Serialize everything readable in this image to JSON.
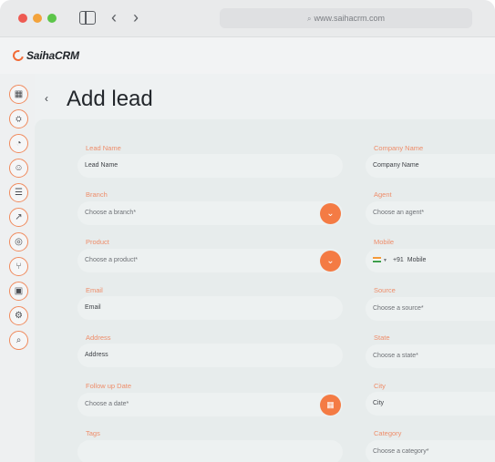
{
  "browser": {
    "url": "www.saihacrm.com"
  },
  "app": {
    "brand": "SaihaCRM"
  },
  "rail": {
    "items": [
      {
        "icon": "dashboard-icon",
        "glyph": "▦"
      },
      {
        "icon": "handshake-icon",
        "glyph": "🤝"
      },
      {
        "icon": "chart-pie-icon",
        "glyph": "◔"
      },
      {
        "icon": "people-icon",
        "glyph": "☺"
      },
      {
        "icon": "report-icon",
        "glyph": "☰"
      },
      {
        "icon": "trend-icon",
        "glyph": "↗"
      },
      {
        "icon": "globe-icon",
        "glyph": "◎"
      },
      {
        "icon": "branch-icon",
        "glyph": "⑂"
      },
      {
        "icon": "image-icon",
        "glyph": "▣"
      },
      {
        "icon": "settings-icon",
        "glyph": "⚙"
      },
      {
        "icon": "search-icon",
        "glyph": "⌕"
      }
    ]
  },
  "page": {
    "title": "Add lead"
  },
  "form": {
    "lead_name": {
      "label": "Lead Name",
      "value": "Lead Name"
    },
    "branch": {
      "label": "Branch",
      "placeholder": "Choose a branch*"
    },
    "product": {
      "label": "Product",
      "placeholder": "Choose a product*"
    },
    "email": {
      "label": "Email",
      "value": "Email"
    },
    "address": {
      "label": "Address",
      "value": "Address"
    },
    "follow_up": {
      "label": "Follow up Date",
      "placeholder": "Choose a date*"
    },
    "tags": {
      "label": "Tags",
      "value": "Tags"
    },
    "company_name": {
      "label": "Company Name",
      "value": "Company Name"
    },
    "agent": {
      "label": "Agent",
      "placeholder": "Choose an agent*"
    },
    "mobile": {
      "label": "Mobile",
      "code": "+91",
      "value": "Mobile"
    },
    "source": {
      "label": "Source",
      "placeholder": "Choose a source*"
    },
    "state": {
      "label": "State",
      "placeholder": "Choose a state*"
    },
    "city": {
      "label": "City",
      "value": "City"
    },
    "category": {
      "label": "Category",
      "placeholder": "Choose a category*"
    }
  },
  "colors": {
    "accent": "#f47b44",
    "label": "#ee8d6a"
  }
}
